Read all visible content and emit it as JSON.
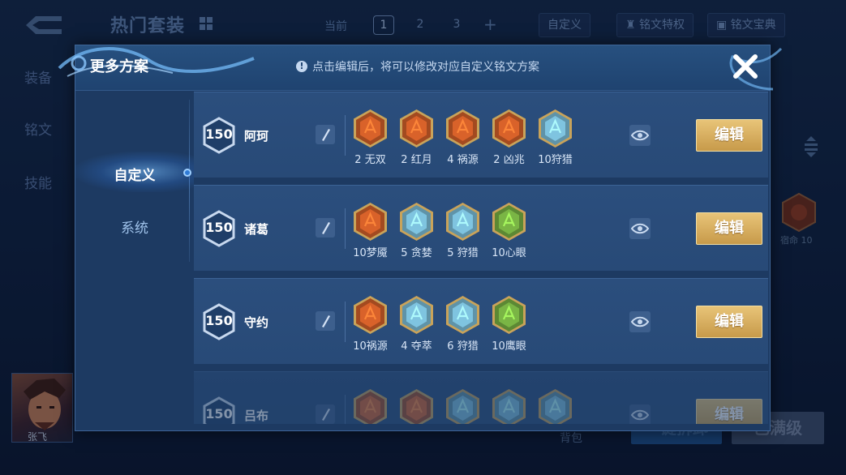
{
  "background": {
    "title": "热门套装",
    "current_label": "当前",
    "pages": [
      "1",
      "2",
      "3"
    ],
    "plus": "+",
    "custom_label": "自定义",
    "privilege_label": "铭文特权",
    "treasure_label": "铭文宝典",
    "side_items": [
      "装备",
      "铭文",
      "技能"
    ],
    "rune_label": "宿命 10",
    "hero_name": "张飞",
    "bag_label": "背包",
    "equip_btn": "一键拆卸",
    "maxlevel_btn": "已满级"
  },
  "modal": {
    "title": "更多方案",
    "hint": "点击编辑后，将可以修改对应自定义铭文方案",
    "tabs": [
      {
        "label": "自定义",
        "active": true
      },
      {
        "label": "系统",
        "active": false
      }
    ],
    "edit_label": "编辑",
    "rows": [
      {
        "level": "150",
        "hero": "阿珂",
        "runes": [
          {
            "label": "2 无双",
            "color": "#d9622a",
            "icon": "red-rune-icon"
          },
          {
            "label": "2 红月",
            "color": "#d9622a",
            "icon": "red-rune-icon"
          },
          {
            "label": "4 祸源",
            "color": "#d9622a",
            "icon": "red-rune-icon"
          },
          {
            "label": "2 凶兆",
            "color": "#d9622a",
            "icon": "red-rune-icon"
          },
          {
            "label": "10狩猎",
            "color": "#7fc4e0",
            "icon": "blue-rune-icon"
          }
        ]
      },
      {
        "level": "150",
        "hero": "诸葛",
        "runes": [
          {
            "label": "10梦魇",
            "color": "#d9622a",
            "icon": "red-rune-icon"
          },
          {
            "label": "5 贪婪",
            "color": "#7fc4e0",
            "icon": "blue-rune-icon"
          },
          {
            "label": "5 狩猎",
            "color": "#7fc4e0",
            "icon": "blue-rune-icon"
          },
          {
            "label": "10心眼",
            "color": "#7ab545",
            "icon": "green-rune-icon"
          }
        ]
      },
      {
        "level": "150",
        "hero": "守约",
        "runes": [
          {
            "label": "10祸源",
            "color": "#d9622a",
            "icon": "red-rune-icon"
          },
          {
            "label": "4 夺萃",
            "color": "#7fc4e0",
            "icon": "blue-rune-icon"
          },
          {
            "label": "6 狩猎",
            "color": "#7fc4e0",
            "icon": "blue-rune-icon"
          },
          {
            "label": "10鹰眼",
            "color": "#7ab545",
            "icon": "green-rune-icon"
          }
        ]
      },
      {
        "level": "150",
        "hero": "吕布",
        "runes": [
          {
            "label": "",
            "color": "#d9622a",
            "icon": "red-rune-icon"
          },
          {
            "label": "",
            "color": "#d9622a",
            "icon": "red-rune-icon"
          },
          {
            "label": "",
            "color": "#7fc4e0",
            "icon": "blue-rune-icon"
          },
          {
            "label": "",
            "color": "#7fc4e0",
            "icon": "blue-rune-icon"
          },
          {
            "label": "",
            "color": "#7fc4e0",
            "icon": "blue-rune-icon"
          }
        ]
      }
    ]
  },
  "colors": {
    "edit_button": "#d8b062",
    "panel": "#1d3a62",
    "row": "#2a4c7a"
  }
}
